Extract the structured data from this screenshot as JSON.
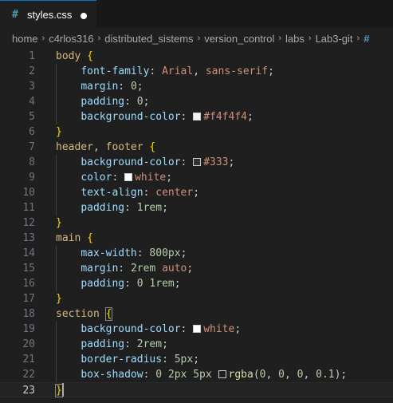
{
  "tab": {
    "icon": "#",
    "label": "styles.css",
    "dirty": true
  },
  "breadcrumb": [
    "home",
    "c4rlos316",
    "distributed_sistems",
    "version_control",
    "labs",
    "Lab3-git",
    "#"
  ],
  "editor": {
    "active_line": 23,
    "lines": [
      {
        "n": "1",
        "tokens": [
          [
            "sel",
            "body"
          ],
          [
            "punc",
            " "
          ],
          [
            "brace",
            "{"
          ]
        ]
      },
      {
        "n": "2",
        "tokens": [
          [
            "punc",
            "    "
          ],
          [
            "prop",
            "font-family"
          ],
          [
            "punc",
            ": "
          ],
          [
            "val",
            "Arial"
          ],
          [
            "punc",
            ", "
          ],
          [
            "val",
            "sans-serif"
          ],
          [
            "punc",
            ";"
          ]
        ]
      },
      {
        "n": "3",
        "tokens": [
          [
            "punc",
            "    "
          ],
          [
            "prop",
            "margin"
          ],
          [
            "punc",
            ": "
          ],
          [
            "num",
            "0"
          ],
          [
            "punc",
            ";"
          ]
        ]
      },
      {
        "n": "4",
        "tokens": [
          [
            "punc",
            "    "
          ],
          [
            "prop",
            "padding"
          ],
          [
            "punc",
            ": "
          ],
          [
            "num",
            "0"
          ],
          [
            "punc",
            ";"
          ]
        ]
      },
      {
        "n": "5",
        "tokens": [
          [
            "punc",
            "    "
          ],
          [
            "prop",
            "background-color"
          ],
          [
            "punc",
            ": "
          ],
          [
            "swatch",
            "#f4f4f4"
          ],
          [
            "val",
            "#f4f4f4"
          ],
          [
            "punc",
            ";"
          ]
        ]
      },
      {
        "n": "6",
        "tokens": [
          [
            "brace",
            "}"
          ]
        ]
      },
      {
        "n": "7",
        "tokens": [
          [
            "sel",
            "header"
          ],
          [
            "punc",
            ", "
          ],
          [
            "sel",
            "footer"
          ],
          [
            "punc",
            " "
          ],
          [
            "brace",
            "{"
          ]
        ]
      },
      {
        "n": "8",
        "tokens": [
          [
            "punc",
            "    "
          ],
          [
            "prop",
            "background-color"
          ],
          [
            "punc",
            ": "
          ],
          [
            "swatch",
            "#333"
          ],
          [
            "val",
            "#333"
          ],
          [
            "punc",
            ";"
          ]
        ]
      },
      {
        "n": "9",
        "tokens": [
          [
            "punc",
            "    "
          ],
          [
            "prop",
            "color"
          ],
          [
            "punc",
            ": "
          ],
          [
            "swatch",
            "white"
          ],
          [
            "val",
            "white"
          ],
          [
            "punc",
            ";"
          ]
        ]
      },
      {
        "n": "10",
        "tokens": [
          [
            "punc",
            "    "
          ],
          [
            "prop",
            "text-align"
          ],
          [
            "punc",
            ": "
          ],
          [
            "val",
            "center"
          ],
          [
            "punc",
            ";"
          ]
        ]
      },
      {
        "n": "11",
        "tokens": [
          [
            "punc",
            "    "
          ],
          [
            "prop",
            "padding"
          ],
          [
            "punc",
            ": "
          ],
          [
            "num",
            "1rem"
          ],
          [
            "punc",
            ";"
          ]
        ]
      },
      {
        "n": "12",
        "tokens": [
          [
            "brace",
            "}"
          ]
        ]
      },
      {
        "n": "13",
        "tokens": [
          [
            "sel",
            "main"
          ],
          [
            "punc",
            " "
          ],
          [
            "brace",
            "{"
          ]
        ]
      },
      {
        "n": "14",
        "tokens": [
          [
            "punc",
            "    "
          ],
          [
            "prop",
            "max-width"
          ],
          [
            "punc",
            ": "
          ],
          [
            "num",
            "800px"
          ],
          [
            "punc",
            ";"
          ]
        ]
      },
      {
        "n": "15",
        "tokens": [
          [
            "punc",
            "    "
          ],
          [
            "prop",
            "margin"
          ],
          [
            "punc",
            ": "
          ],
          [
            "num",
            "2rem"
          ],
          [
            "punc",
            " "
          ],
          [
            "val",
            "auto"
          ],
          [
            "punc",
            ";"
          ]
        ]
      },
      {
        "n": "16",
        "tokens": [
          [
            "punc",
            "    "
          ],
          [
            "prop",
            "padding"
          ],
          [
            "punc",
            ": "
          ],
          [
            "num",
            "0"
          ],
          [
            "punc",
            " "
          ],
          [
            "num",
            "1rem"
          ],
          [
            "punc",
            ";"
          ]
        ]
      },
      {
        "n": "17",
        "tokens": [
          [
            "brace",
            "}"
          ]
        ]
      },
      {
        "n": "18",
        "tokens": [
          [
            "sel",
            "section"
          ],
          [
            "punc",
            " "
          ],
          [
            "bracem",
            "{"
          ]
        ]
      },
      {
        "n": "19",
        "tokens": [
          [
            "punc",
            "    "
          ],
          [
            "prop",
            "background-color"
          ],
          [
            "punc",
            ": "
          ],
          [
            "swatch",
            "white"
          ],
          [
            "val",
            "white"
          ],
          [
            "punc",
            ";"
          ]
        ]
      },
      {
        "n": "20",
        "tokens": [
          [
            "punc",
            "    "
          ],
          [
            "prop",
            "padding"
          ],
          [
            "punc",
            ": "
          ],
          [
            "num",
            "2rem"
          ],
          [
            "punc",
            ";"
          ]
        ]
      },
      {
        "n": "21",
        "tokens": [
          [
            "punc",
            "    "
          ],
          [
            "prop",
            "border-radius"
          ],
          [
            "punc",
            ": "
          ],
          [
            "num",
            "5px"
          ],
          [
            "punc",
            ";"
          ]
        ]
      },
      {
        "n": "22",
        "tokens": [
          [
            "punc",
            "    "
          ],
          [
            "prop",
            "box-shadow"
          ],
          [
            "punc",
            ": "
          ],
          [
            "num",
            "0"
          ],
          [
            "punc",
            " "
          ],
          [
            "num",
            "2px"
          ],
          [
            "punc",
            " "
          ],
          [
            "num",
            "5px"
          ],
          [
            "punc",
            " "
          ],
          [
            "swatch",
            "rgba(0,0,0,0.1)"
          ],
          [
            "fn",
            "rgba"
          ],
          [
            "punc",
            "("
          ],
          [
            "num",
            "0"
          ],
          [
            "punc",
            ", "
          ],
          [
            "num",
            "0"
          ],
          [
            "punc",
            ", "
          ],
          [
            "num",
            "0"
          ],
          [
            "punc",
            ", "
          ],
          [
            "num",
            "0.1"
          ],
          [
            "punc",
            ");"
          ]
        ]
      },
      {
        "n": "23",
        "tokens": [
          [
            "bracem",
            "}"
          ]
        ]
      }
    ]
  },
  "colors": {
    "accent": "#0078d4",
    "selector": "#d7ba7d",
    "property": "#9cdcfe",
    "value": "#ce9178",
    "number": "#b5cea8",
    "brace": "#ffd700"
  }
}
